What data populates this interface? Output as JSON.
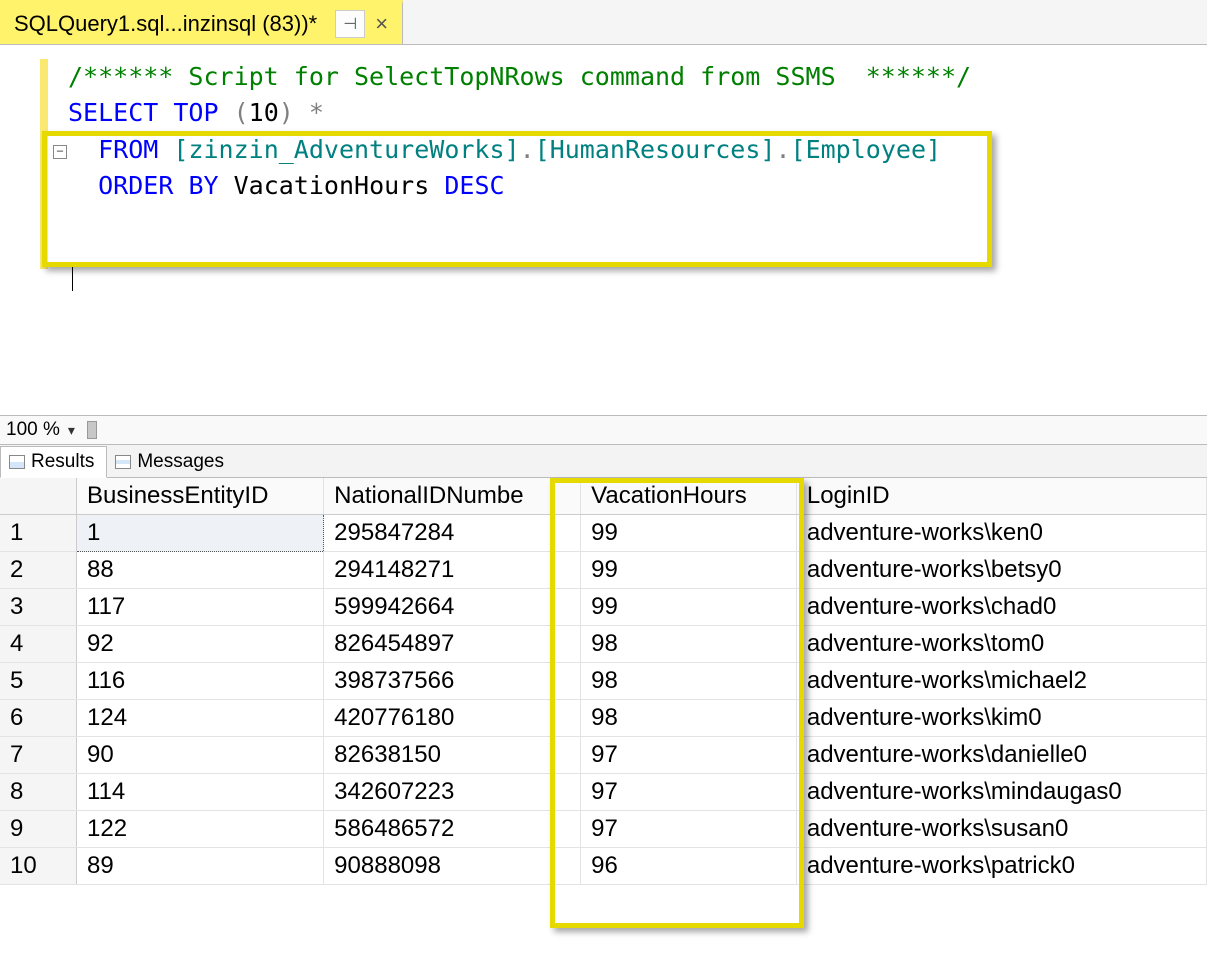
{
  "tab": {
    "title": "SQLQuery1.sql...inzinsql (83))*",
    "pin_glyph": "⊣",
    "close_glyph": "×"
  },
  "editor": {
    "collapse_glyph": "−",
    "comment_line": "/****** Script for SelectTopNRows command from SSMS  ******/",
    "l1_kw1": "SELECT",
    "l1_kw2": "TOP",
    "l1_open": "(",
    "l1_num": "10",
    "l1_close": ")",
    "l1_star": "*",
    "l2_kw": "FROM",
    "l2_id1": "[zinzin_AdventureWorks]",
    "l2_dot1": ".",
    "l2_id2": "[HumanResources]",
    "l2_dot2": ".",
    "l2_id3": "[Employee]",
    "l3_kw1": "ORDER",
    "l3_kw2": "BY",
    "l3_col": "VacationHours",
    "l3_kw3": "DESC"
  },
  "zoom": {
    "level": "100 %",
    "caret": "▾"
  },
  "result_tabs": {
    "results": "Results",
    "messages": "Messages"
  },
  "columns": {
    "c1": "BusinessEntityID",
    "c2": "NationalIDNumbe",
    "c3": "VacationHours",
    "c4": "LoginID"
  },
  "rows": [
    {
      "n": "1",
      "c1": "1",
      "c2": "295847284",
      "c3": "99",
      "c4": "adventure-works\\ken0"
    },
    {
      "n": "2",
      "c1": "88",
      "c2": "294148271",
      "c3": "99",
      "c4": "adventure-works\\betsy0"
    },
    {
      "n": "3",
      "c1": "117",
      "c2": "599942664",
      "c3": "99",
      "c4": "adventure-works\\chad0"
    },
    {
      "n": "4",
      "c1": "92",
      "c2": "826454897",
      "c3": "98",
      "c4": "adventure-works\\tom0"
    },
    {
      "n": "5",
      "c1": "116",
      "c2": "398737566",
      "c3": "98",
      "c4": "adventure-works\\michael2"
    },
    {
      "n": "6",
      "c1": "124",
      "c2": "420776180",
      "c3": "98",
      "c4": "adventure-works\\kim0"
    },
    {
      "n": "7",
      "c1": "90",
      "c2": "82638150",
      "c3": "97",
      "c4": "adventure-works\\danielle0"
    },
    {
      "n": "8",
      "c1": "114",
      "c2": "342607223",
      "c3": "97",
      "c4": "adventure-works\\mindaugas0"
    },
    {
      "n": "9",
      "c1": "122",
      "c2": "586486572",
      "c3": "97",
      "c4": "adventure-works\\susan0"
    },
    {
      "n": "10",
      "c1": "89",
      "c2": "90888098",
      "c3": "96",
      "c4": "adventure-works\\patrick0"
    }
  ]
}
